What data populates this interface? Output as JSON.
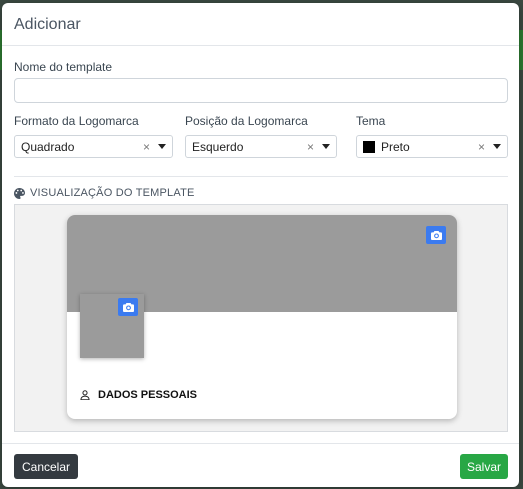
{
  "modal": {
    "title": "Adicionar"
  },
  "form": {
    "template_name_label": "Nome do template",
    "template_name_value": "",
    "logo_format": {
      "label": "Formato da Logomarca",
      "value": "Quadrado",
      "clear": "×"
    },
    "logo_position": {
      "label": "Posição da Logomarca",
      "value": "Esquerdo",
      "clear": "×"
    },
    "theme": {
      "label": "Tema",
      "value": "Preto",
      "clear": "×",
      "swatch_color": "#000000"
    }
  },
  "preview": {
    "section_title": "VISUALIZAÇÃO DO TEMPLATE",
    "section_icon": "palette-icon",
    "banner_color": "#9b9b9b",
    "banner_camera_icon": "camera-icon",
    "logo_camera_icon": "camera-icon",
    "personal_section_icon": "user-icon",
    "personal_section_label": "DADOS PESSOAIS"
  },
  "footer": {
    "cancel_label": "Cancelar",
    "save_label": "Salvar"
  },
  "colors": {
    "accent_blue": "#3b7bf0",
    "save_green": "#28a745",
    "cancel_dark": "#343a40"
  }
}
